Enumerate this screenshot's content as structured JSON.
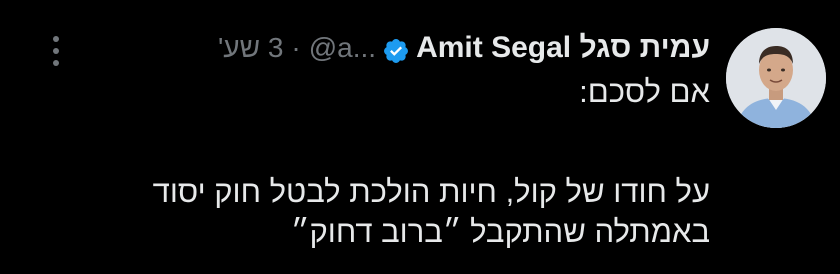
{
  "tweet": {
    "display_name_he": "עמית סגל",
    "display_name_en": "Amit Segal",
    "handle": "@a...",
    "separator": "·",
    "time": "3 שע'",
    "more_icon": "more-horizontal-icon",
    "verified_icon": "verified-badge-icon",
    "text": {
      "line1": "אם לסכם:",
      "line2": "על חודו של קול, חיות הולכת לבטל חוק יסוד",
      "line3": "באמתלה שהתקבל ״ברוב דחוק״"
    }
  },
  "colors": {
    "background": "#000000",
    "primary_text": "#e7e9ea",
    "secondary_text": "#71767b",
    "verified": "#1d9bf0"
  }
}
